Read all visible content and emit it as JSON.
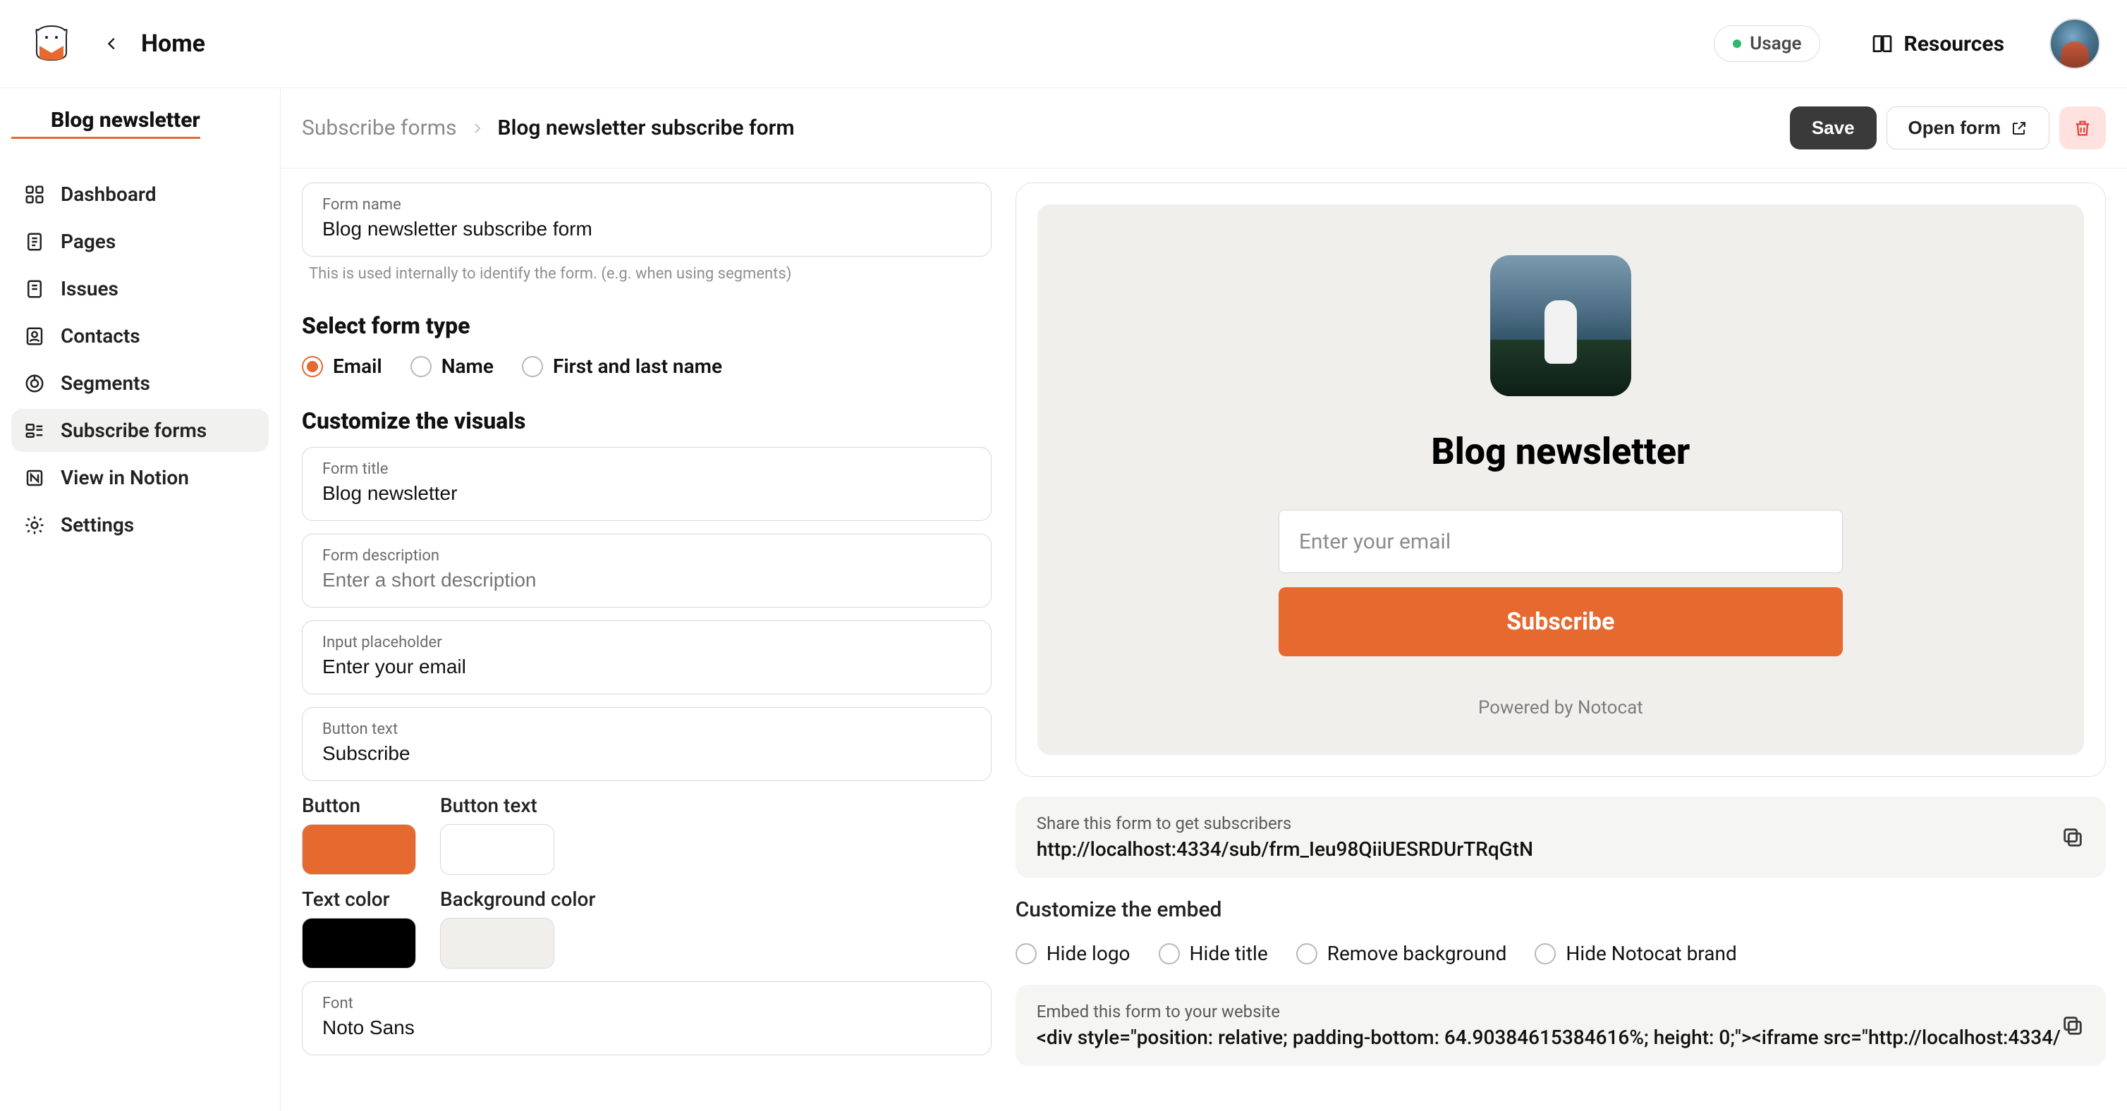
{
  "topbar": {
    "home_label": "Home",
    "usage_label": "Usage",
    "resources_label": "Resources"
  },
  "sidebar": {
    "title": "Blog newsletter",
    "items": [
      {
        "label": "Dashboard"
      },
      {
        "label": "Pages"
      },
      {
        "label": "Issues"
      },
      {
        "label": "Contacts"
      },
      {
        "label": "Segments"
      },
      {
        "label": "Subscribe forms"
      },
      {
        "label": "View in Notion"
      },
      {
        "label": "Settings"
      }
    ]
  },
  "breadcrumb": {
    "parent": "Subscribe forms",
    "current": "Blog newsletter subscribe form"
  },
  "actions": {
    "save": "Save",
    "open_form": "Open form"
  },
  "fields": {
    "form_name": {
      "label": "Form name",
      "value": "Blog newsletter subscribe form"
    },
    "form_name_hint": "This is used internally to identify the form. (e.g. when using segments)",
    "form_title": {
      "label": "Form title",
      "value": "Blog newsletter"
    },
    "form_description": {
      "label": "Form description",
      "placeholder": "Enter a short description"
    },
    "input_placeholder": {
      "label": "Input placeholder",
      "value": "Enter your email"
    },
    "button_text": {
      "label": "Button text",
      "value": "Subscribe"
    },
    "font": {
      "label": "Font",
      "value": "Noto Sans"
    }
  },
  "sections": {
    "select_form_type": "Select form type",
    "customize_visuals": "Customize the visuals"
  },
  "form_type_options": {
    "email": "Email",
    "name": "Name",
    "first_last": "First and last name"
  },
  "color_labels": {
    "button": "Button",
    "button_text": "Button text",
    "text_color": "Text color",
    "background_color": "Background color"
  },
  "colors": {
    "button": "#e6692f",
    "button_text": "#ffffff",
    "text": "#000000",
    "background": "#f0efec"
  },
  "preview": {
    "title": "Blog newsletter",
    "placeholder": "Enter your email",
    "button": "Subscribe",
    "powered": "Powered by Notocat"
  },
  "share": {
    "label": "Share this form to get subscribers",
    "url": "http://localhost:4334/sub/frm_Ieu98QiiUESRDUrTRqGtN"
  },
  "embed": {
    "heading": "Customize the embed",
    "options": {
      "hide_logo": "Hide logo",
      "hide_title": "Hide title",
      "remove_bg": "Remove background",
      "hide_brand": "Hide Notocat brand"
    },
    "code_label": "Embed this form to your website",
    "code": "<div style=\"position: relative; padding-bottom: 64.90384615384616%; height: 0;\"><iframe src=\"http://localhost:4334/"
  }
}
